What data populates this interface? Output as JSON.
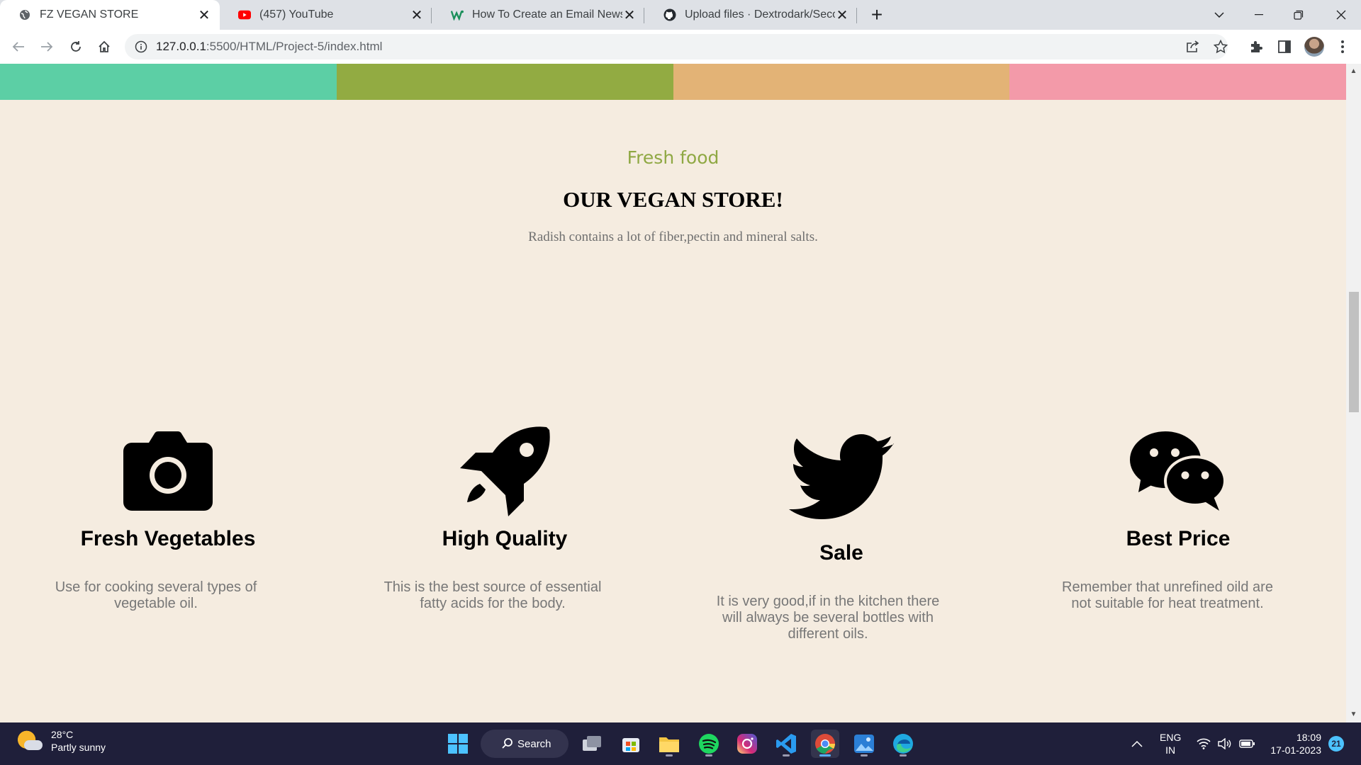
{
  "browser": {
    "tabs": [
      {
        "title": "FZ VEGAN STORE",
        "icon": "globe-icon"
      },
      {
        "title": "(457) YouTube",
        "icon": "youtube-icon"
      },
      {
        "title": "How To Create an Email Newsletter",
        "icon": "w-logo-icon"
      },
      {
        "title": "Upload files · Dextrodark/Second",
        "icon": "github-icon"
      }
    ],
    "new_tab": "+",
    "url_host": "127.0.0.1",
    "url_rest": ":5500/HTML/Project-5/index.html"
  },
  "page": {
    "band_colors": [
      "#5ccfa5",
      "#92ab42",
      "#e3b376",
      "#f39aa9"
    ],
    "eyebrow": "Fresh food",
    "title": "OUR VEGAN STORE!",
    "lead": "Radish contains a lot of fiber,pectin and mineral salts.",
    "features": [
      {
        "icon": "camera-icon",
        "title": "Fresh Vegetables",
        "text": "Use for cooking several types of vegetable oil."
      },
      {
        "icon": "rocket-icon",
        "title": "High Quality",
        "text": "This is the best source of essential fatty acids for the body."
      },
      {
        "icon": "twitter-bird-icon",
        "title": "Sale",
        "text": "It is very good,if in the kitchen there will always be several bottles with different oils."
      },
      {
        "icon": "wechat-icon",
        "title": "Best Price",
        "text": "Remember that unrefined oild are not suitable for heat treatment."
      }
    ]
  },
  "taskbar": {
    "weather_temp": "28°C",
    "weather_desc": "Partly sunny",
    "search_label": "Search",
    "lang_1": "ENG",
    "lang_2": "IN",
    "time": "18:09",
    "date": "17-01-2023",
    "notifications": "21"
  }
}
